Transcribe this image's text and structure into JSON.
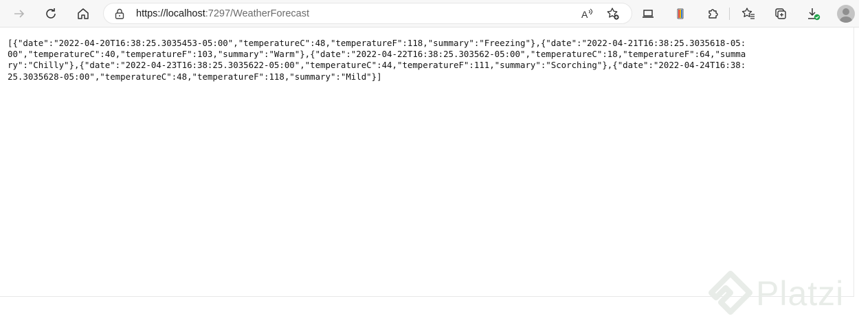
{
  "browser": {
    "url_host": "https://localhost",
    "url_rest": ":7297/WeatherForecast",
    "icons": [
      "forward-icon",
      "refresh-icon",
      "home-icon",
      "lock-icon",
      "read-aloud-icon",
      "favorite-add-icon",
      "devices-icon",
      "extension-swatch-icon",
      "extensions-icon",
      "favorites-icon",
      "collections-icon",
      "downloads-icon",
      "profile-avatar"
    ]
  },
  "page": {
    "json_text": "[{\"date\":\"2022-04-20T16:38:25.3035453-05:00\",\"temperatureC\":48,\"temperatureF\":118,\"summary\":\"Freezing\"},{\"date\":\"2022-04-21T16:38:25.3035618-05:00\",\"temperatureC\":40,\"temperatureF\":103,\"summary\":\"Warm\"},{\"date\":\"2022-04-22T16:38:25.303562-05:00\",\"temperatureC\":18,\"temperatureF\":64,\"summary\":\"Chilly\"},{\"date\":\"2022-04-23T16:38:25.3035622-05:00\",\"temperatureC\":44,\"temperatureF\":111,\"summary\":\"Scorching\"},{\"date\":\"2022-04-24T16:38:25.3035628-05:00\",\"temperatureC\":48,\"temperatureF\":118,\"summary\":\"Mild\"}]"
  },
  "watermark": {
    "text": "Platzi"
  },
  "colors": {
    "accent_download": "#1fa34a",
    "toolbar_bg": "#f7f7f7"
  }
}
